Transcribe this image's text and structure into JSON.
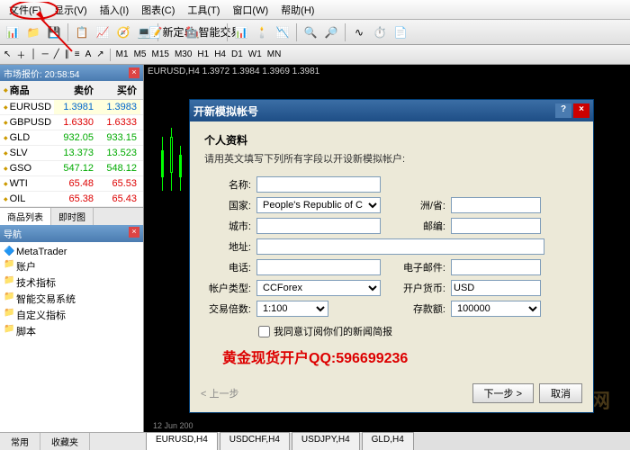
{
  "menu": [
    "文件(F)",
    "显示(V)",
    "插入(I)",
    "图表(C)",
    "工具(T)",
    "窗口(W)",
    "帮助(H)"
  ],
  "toolbar_new_order": "新定单",
  "toolbar_autotrade": "智能交易",
  "timeframes": [
    "M1",
    "M5",
    "M15",
    "M30",
    "H1",
    "H4",
    "D1",
    "W1",
    "MN"
  ],
  "marketwatch": {
    "title": "市场报价: 20:58:54",
    "cols": [
      "商品",
      "卖价",
      "买价"
    ],
    "rows": [
      {
        "sym": "EURUSD",
        "bid": "1.3981",
        "ask": "1.3983",
        "cls": "blue"
      },
      {
        "sym": "GBPUSD",
        "bid": "1.6330",
        "ask": "1.6333",
        "cls": "red"
      },
      {
        "sym": "GLD",
        "bid": "932.05",
        "ask": "933.15",
        "cls": "green"
      },
      {
        "sym": "SLV",
        "bid": "13.373",
        "ask": "13.523",
        "cls": "green"
      },
      {
        "sym": "GSO",
        "bid": "547.12",
        "ask": "548.12",
        "cls": "green"
      },
      {
        "sym": "WTI",
        "bid": "65.48",
        "ask": "65.53",
        "cls": "red"
      },
      {
        "sym": "OIL",
        "bid": "65.38",
        "ask": "65.43",
        "cls": "red"
      }
    ],
    "tabs": [
      "商品列表",
      "即时图"
    ]
  },
  "nav": {
    "title": "导航",
    "items": [
      "MetaTrader",
      "账户",
      "技术指标",
      "智能交易系统",
      "自定义指标",
      "脚本"
    ]
  },
  "chart": {
    "title": "EURUSD,H4  1.3972  1.3984  1.3969  1.3981",
    "xlabel": "12 Jun 200"
  },
  "dialog": {
    "title": "开新模拟帐号",
    "section": "个人资料",
    "hint": "请用英文填写下列所有字段以开设新模拟帐户:",
    "f_name": "名称:",
    "f_country": "国家:",
    "v_country": "People's Republic of C",
    "f_state": "洲/省:",
    "f_city": "城市:",
    "f_zip": "邮编:",
    "f_addr": "地址:",
    "f_phone": "电话:",
    "f_email": "电子邮件:",
    "f_acct": "帐户类型:",
    "v_acct": "CCForex",
    "f_ccy": "开户货币:",
    "v_ccy": "USD",
    "f_lev": "交易倍数:",
    "v_lev": "1:100",
    "f_dep": "存款额:",
    "v_dep": "100000",
    "chk": "我同意订阅你们的新闻简报",
    "banner": "黄金现货开户QQ:596699236",
    "back": "< 上一步",
    "next": "下一步 >",
    "cancel": "取消"
  },
  "charttabs": [
    "EURUSD,H4",
    "USDCHF,H4",
    "USDJPY,H4",
    "GLD,H4"
  ],
  "bottom": [
    "常用",
    "收藏夹"
  ],
  "watermark": "诺理财网"
}
